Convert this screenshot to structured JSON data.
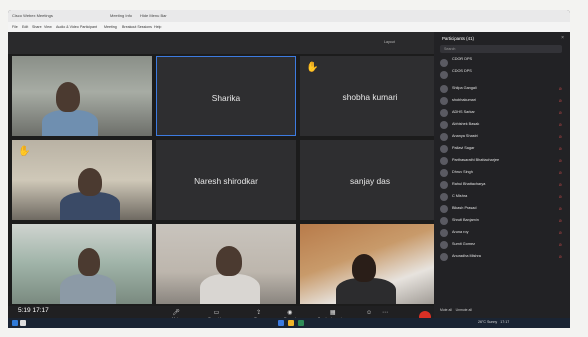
{
  "window": {
    "title": "Cisco Webex Meetings",
    "tabs": [
      "Meeting Info",
      "Hide Menu Bar"
    ]
  },
  "menu": [
    "File",
    "Edit",
    "Share",
    "View",
    "Audio & Video",
    "Participant",
    "Meeting",
    "Breakout Sessions",
    "Help"
  ],
  "meeting": {
    "layout_label": "Layout"
  },
  "tiles": [
    {
      "name": "",
      "kind": "video"
    },
    {
      "name": "Sharika",
      "kind": "name",
      "hand": false
    },
    {
      "name": "shobha kumari",
      "kind": "name",
      "hand": true
    },
    {
      "name": "",
      "kind": "video",
      "hand": true
    },
    {
      "name": "Naresh shirodkar",
      "kind": "name"
    },
    {
      "name": "sanjay das",
      "kind": "name"
    },
    {
      "name": "",
      "kind": "video"
    },
    {
      "name": "",
      "kind": "video"
    },
    {
      "name": "",
      "kind": "video"
    }
  ],
  "toolbar": {
    "mute": "Mute",
    "stop_video": "Stop video",
    "share": "Share",
    "record": "Record",
    "breakout": "Breakout sessions",
    "participants": "Participants",
    "chat": "Chat"
  },
  "clock_overlay": "5:19 17:17",
  "panel": {
    "title": "Participants (41)",
    "search_placeholder": "Search",
    "people": [
      "CDOR DPS",
      "CDOS DPS",
      "Shilpa Gangali",
      "shobhakumari",
      "ADHS Sarkar",
      "Abhishek Basak",
      "Ananya Shastri",
      "Pallavi Sagar",
      "Parthasarathi Bhattacharjee",
      "Dhruv Singh",
      "Rahul Bhattacharya",
      "C Mishra",
      "Bikash Prasad",
      "Shruti Banjamin",
      "Aruna roy",
      "Sumit Gomez",
      "Anuradha Mishra"
    ],
    "bottom_tabs": [
      "Mute all",
      "Unmute all"
    ]
  },
  "taskbar": {
    "weather": "26°C Sunny",
    "time": "17:17"
  },
  "colors": {
    "leave": "#d93025",
    "panel_bg": "#222225",
    "tile_bg": "#2e2e30",
    "hand": "#f0b429"
  }
}
